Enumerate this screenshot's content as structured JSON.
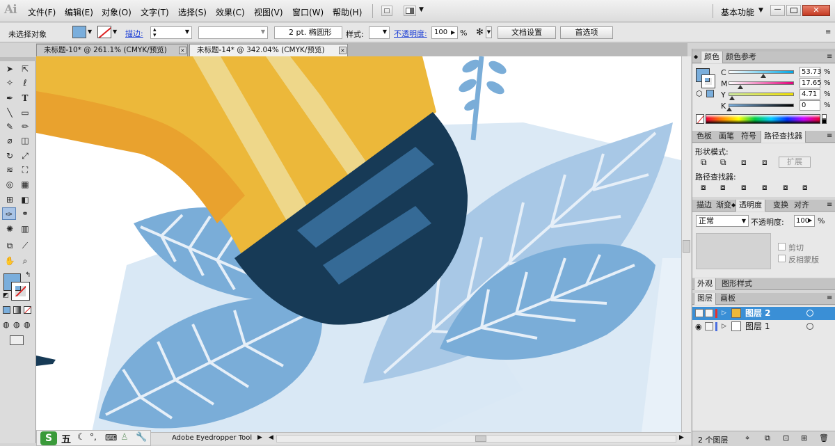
{
  "app": {
    "logo": "Ai",
    "workspace": "基本功能"
  },
  "menu": [
    "文件(F)",
    "编辑(E)",
    "对象(O)",
    "文字(T)",
    "选择(S)",
    "效果(C)",
    "视图(V)",
    "窗口(W)",
    "帮助(H)"
  ],
  "control": {
    "selection_status": "未选择对象",
    "stroke_label": "描边:",
    "brush_value": "2 pt. 椭圆形",
    "style_label": "样式:",
    "opacity_label": "不透明度:",
    "opacity_value": "100",
    "opacity_unit": "%",
    "doc_settings": "文档设置",
    "preferences": "首选项"
  },
  "tabs": [
    {
      "title": "未标题-10* @ 261.1% (CMYK/预览)",
      "close": "×"
    },
    {
      "title": "未标题-14* @ 342.04% (CMYK/预览)",
      "close": "×"
    }
  ],
  "color_panel": {
    "tabs": [
      "颜色",
      "颜色参考"
    ],
    "channels": [
      {
        "label": "C",
        "value": "53.73",
        "unit": "%",
        "fraction": 0.537
      },
      {
        "label": "M",
        "value": "17.65",
        "unit": "%",
        "fraction": 0.177
      },
      {
        "label": "Y",
        "value": "4.71",
        "unit": "%",
        "fraction": 0.047
      },
      {
        "label": "K",
        "value": "0",
        "unit": "%",
        "fraction": 0.0
      }
    ]
  },
  "pathfinder_panel": {
    "tabs": [
      "色板",
      "画笔",
      "符号",
      "路径查找器"
    ],
    "shape_modes": "形状模式:",
    "expand": "扩展",
    "pathfinders": "路径查找器:"
  },
  "transparency_panel": {
    "tabs": [
      "描边",
      "渐变",
      "透明度",
      "变换",
      "对齐"
    ],
    "blend_mode": "正常",
    "opacity_label": "不透明度:",
    "opacity_value": "100",
    "unit": "%",
    "clip": "剪切",
    "invert_mask": "反相蒙版"
  },
  "appearance_tabs": [
    "外观",
    "图形样式"
  ],
  "layers_panel": {
    "tabs": [
      "图层",
      "画板"
    ],
    "layers": [
      {
        "name": "图层 2",
        "selected": true,
        "color": "#e8302b"
      },
      {
        "name": "图层 1",
        "selected": false,
        "color": "#4a6ee0"
      }
    ],
    "count": "2 个图层"
  },
  "status": {
    "tool": "Adobe Eyedropper Tool"
  },
  "taskbar": {
    "ime": "五"
  },
  "colors": {
    "fill": "#7aaedc",
    "brush_yellow": "#ecb83a",
    "brush_orange": "#e9a22e",
    "ferrule": "#173a56",
    "leaf_blue": "#7aadd8",
    "leaf_pale": "#a8c8e6",
    "sky": "#dbe9f5",
    "selection": "#3a8fd6"
  }
}
